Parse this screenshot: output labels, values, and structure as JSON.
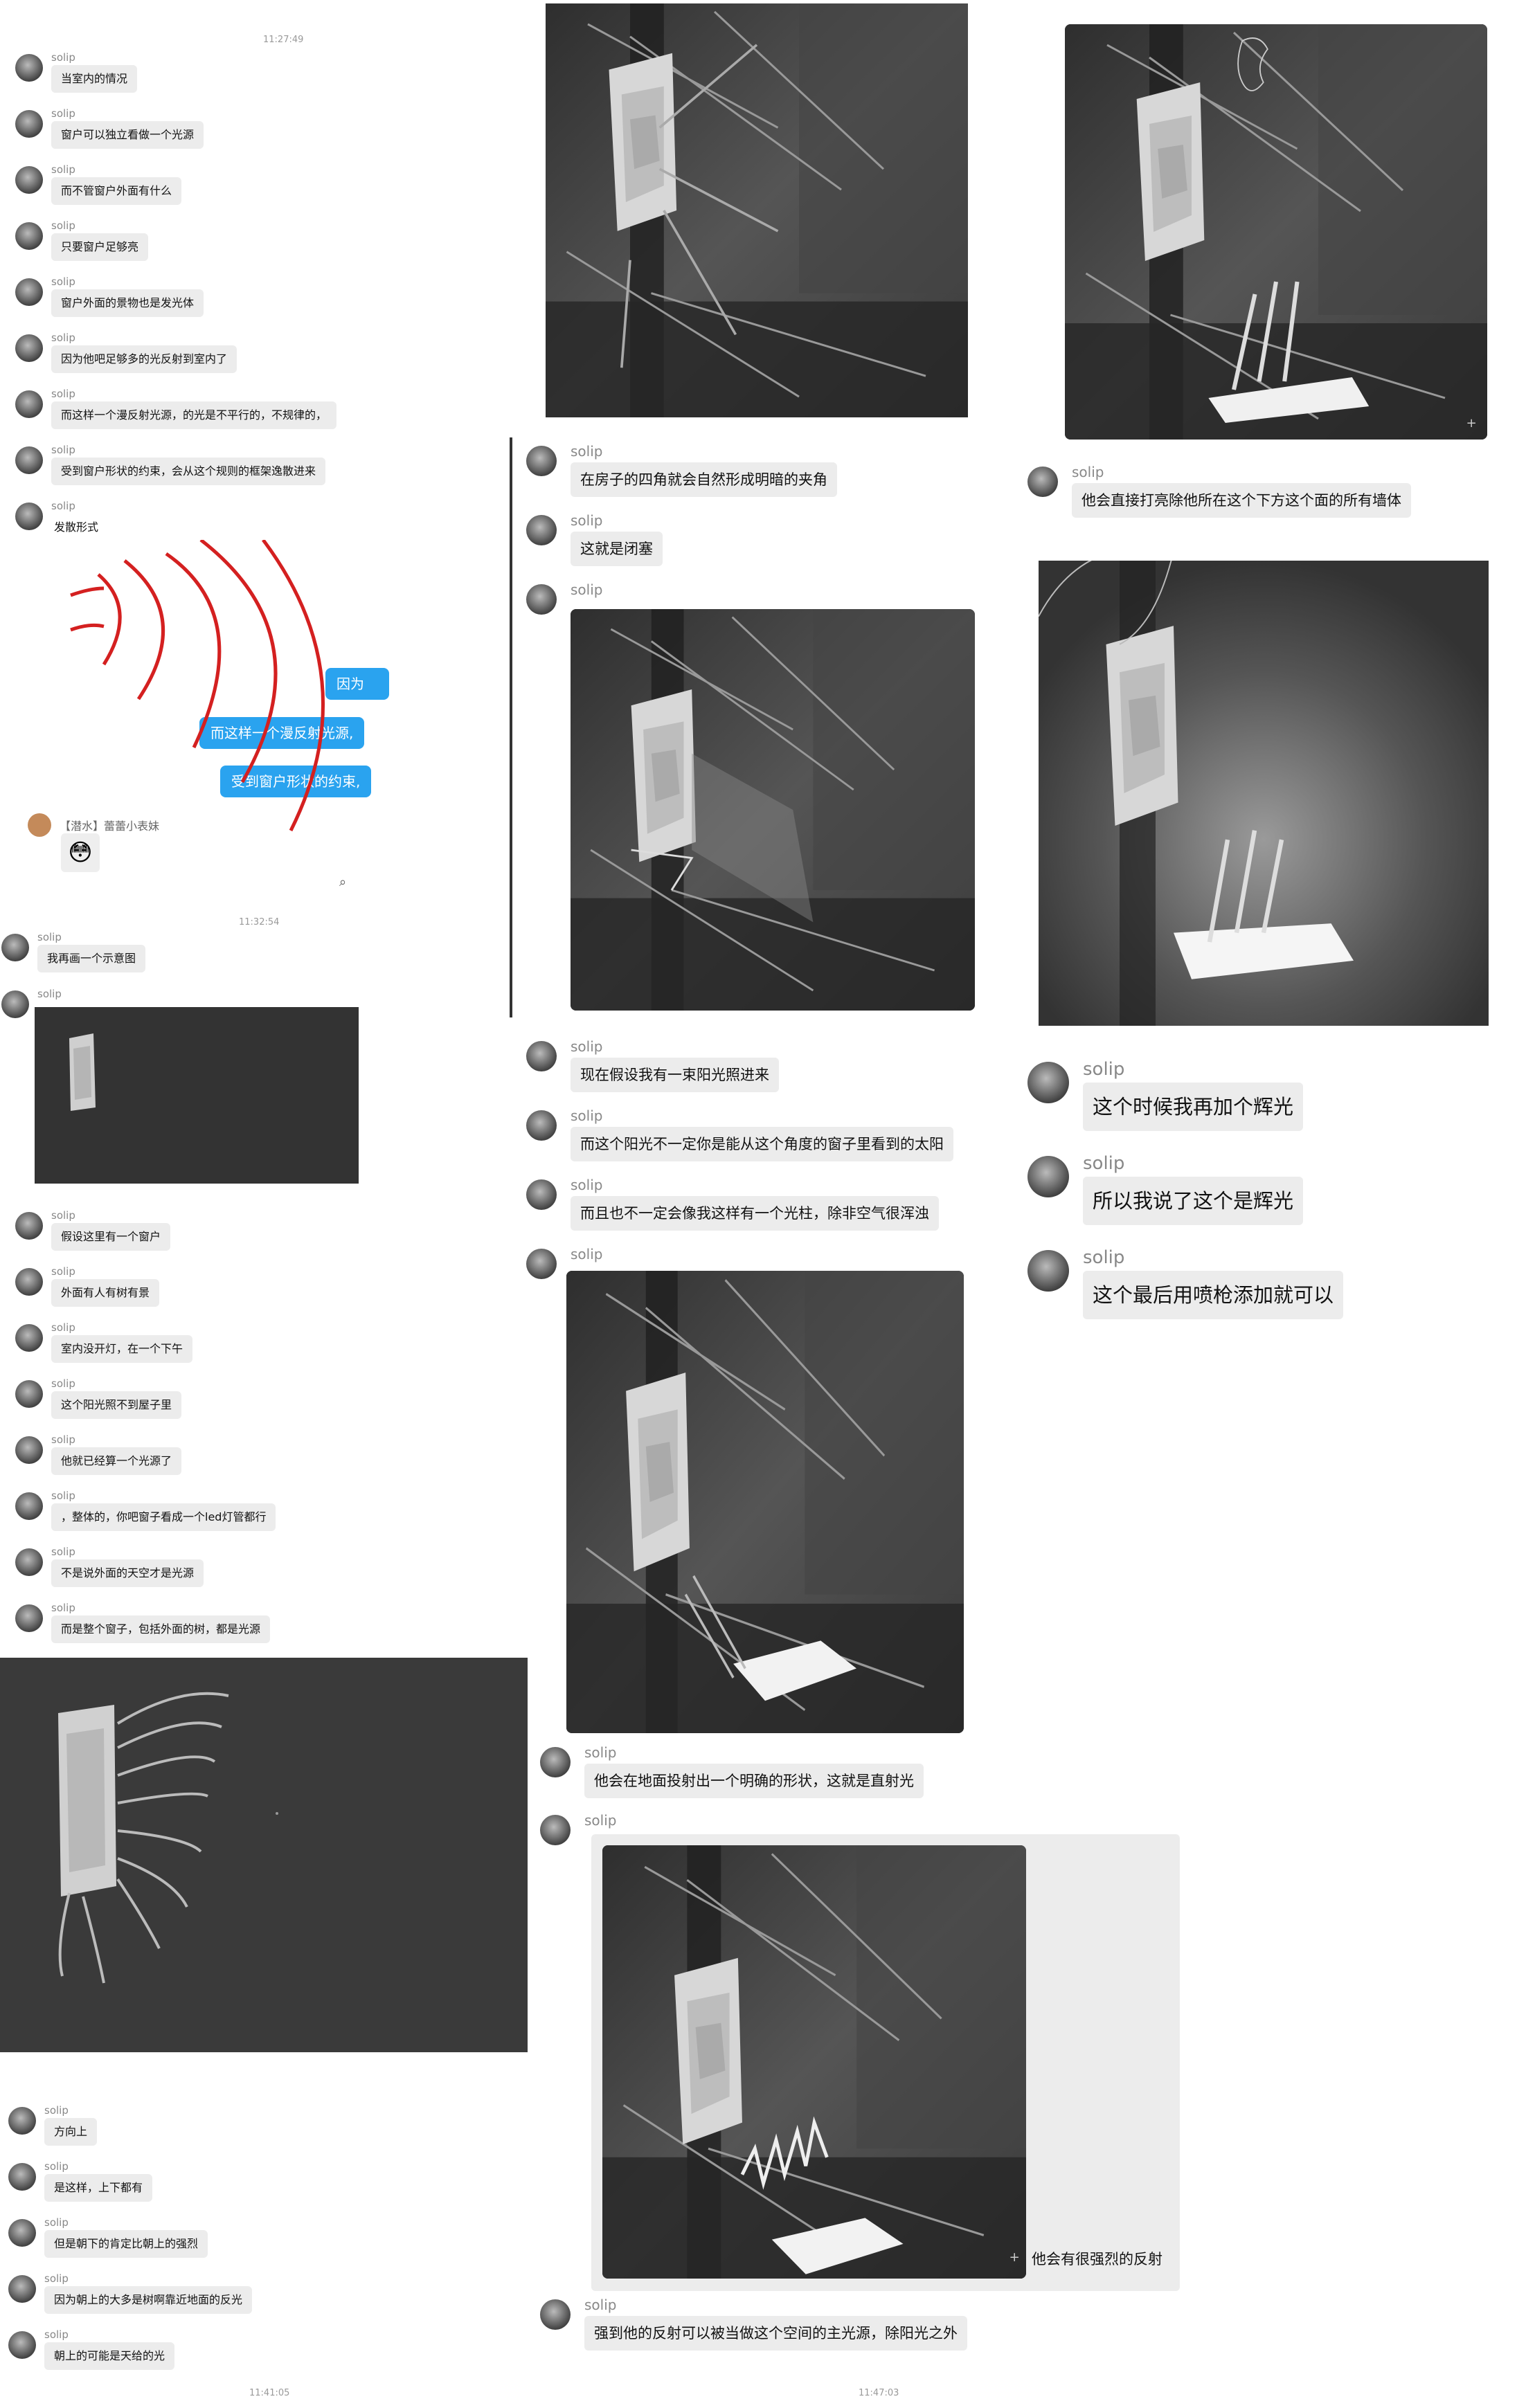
{
  "sender": "solip",
  "col1": {
    "timestamps": [
      "11:27:49",
      "11:32:54",
      "11:41:05"
    ],
    "messages_a": [
      "当室内的情况",
      "窗户可以独立看做一个光源",
      "而不管窗户外面有什么",
      "只要窗户足够亮",
      "窗户外面的景物也是发光体",
      "因为他吧足够多的光反射到室内了",
      "而这样一个漫反射光源，的光是不平行的，不规律的，",
      "受到窗户形状的约束，会从这个规则的框架逸散进来",
      "发散形式"
    ],
    "embedded": {
      "bubble1": "因为",
      "bubble2": "而这样一个漫反射光源,",
      "bubble3": "受到窗户形状的约束,",
      "nick": "【潜水】蕾蕾小表妹"
    },
    "messages_b": [
      "我再画一个示意图"
    ],
    "messages_c": [
      "假设这里有一个窗户",
      "外面有人有树有景",
      "室内没开灯，在一个下午",
      "这个阳光照不到屋子里",
      "他就已经算一个光源了",
      "，整体的，你吧窗子看成一个led灯管都行",
      "不是说外面的天空才是光源",
      "而是整个窗子，包括外面的树，都是光源"
    ],
    "messages_d": [
      "方向上",
      "是这样，上下都有",
      "但是朝下的肯定比朝上的强烈",
      "因为朝上的大多是树啊靠近地面的反光",
      "朝上的可能是天给的光"
    ]
  },
  "col2": {
    "messages_a": [
      "在房子的四角就会自然形成明暗的夹角",
      "这就是闭塞"
    ],
    "messages_b": [
      "现在假设我有一束阳光照进来",
      "而这个阳光不一定你是能从这个角度的窗子里看到的太阳",
      "而且也不一定会像我这样有一个光柱，除非空气很浑浊"
    ],
    "messages_c": [
      "他会在地面投射出一个明确的形状，这就是直射光"
    ],
    "caption": "他会有很强烈的反射",
    "messages_d": [
      "强到他的反射可以被当做这个空间的主光源，除阳光之外"
    ],
    "timestamp_end": "11:47:03"
  },
  "col3": {
    "messages_a": [
      "他会直接打亮除他所在这个下方这个面的所有墙体"
    ],
    "messages_b": [
      "这个时候我再加个辉光",
      "所以我说了这个是辉光",
      "这个最后用喷枪添加就可以"
    ]
  },
  "colors": {
    "bubble": "#ececec",
    "chat_blue": "#2aa3ef",
    "canvas": "#333333",
    "sketch_red": "#d42020"
  }
}
